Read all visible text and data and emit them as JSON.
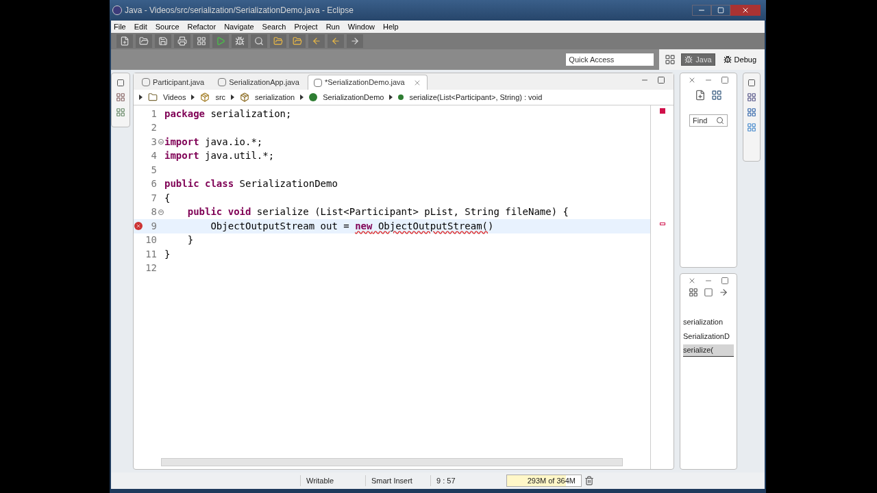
{
  "window": {
    "title": "Java - Videos/src/serialization/SerializationDemo.java - Eclipse"
  },
  "menu": [
    "File",
    "Edit",
    "Source",
    "Refactor",
    "Navigate",
    "Search",
    "Project",
    "Run",
    "Window",
    "Help"
  ],
  "quick_access": {
    "placeholder": "Quick Access"
  },
  "perspectives": [
    {
      "label": "Java",
      "selected": true
    },
    {
      "label": "Debug",
      "selected": false
    }
  ],
  "editor_tabs": [
    {
      "label": "Participant.java",
      "selected": false
    },
    {
      "label": "SerializationApp.java",
      "selected": false
    },
    {
      "label": "*SerializationDemo.java",
      "selected": true
    }
  ],
  "breadcrumb": [
    {
      "label": "Videos",
      "kind": "project"
    },
    {
      "label": "src",
      "kind": "folder"
    },
    {
      "label": "serialization",
      "kind": "package"
    },
    {
      "label": "SerializationDemo",
      "kind": "class"
    },
    {
      "label": "serialize(List<Participant>, String) : void",
      "kind": "method"
    }
  ],
  "code_lines": [
    {
      "number": "1",
      "current": false,
      "error": false,
      "fold": false,
      "tokens": [
        {
          "text": "package",
          "kind": "keyword"
        },
        {
          "text": " serialization;",
          "kind": "plain"
        }
      ]
    },
    {
      "number": "2",
      "current": false,
      "error": false,
      "fold": false
    },
    {
      "number": "3",
      "current": false,
      "error": false,
      "fold": true,
      "tokens": [
        {
          "text": "import",
          "kind": "keyword"
        },
        {
          "text": " java.io.*;",
          "kind": "plain"
        }
      ]
    },
    {
      "number": "4",
      "current": false,
      "error": false,
      "fold": false,
      "tokens": [
        {
          "text": "import",
          "kind": "keyword"
        },
        {
          "text": " java.util.*;",
          "kind": "plain"
        }
      ]
    },
    {
      "number": "5",
      "current": false,
      "error": false,
      "fold": false
    },
    {
      "number": "6",
      "current": false,
      "error": false,
      "fold": false,
      "tokens": [
        {
          "text": "public class",
          "kind": "keyword"
        },
        {
          "text": " SerializationDemo",
          "kind": "plain"
        }
      ]
    },
    {
      "number": "7",
      "current": false,
      "error": false,
      "fold": false,
      "tokens": [
        {
          "text": "{",
          "kind": "plain"
        }
      ]
    },
    {
      "number": "8",
      "current": false,
      "error": false,
      "fold": true,
      "tokens": [
        {
          "text": "    public void",
          "kind": "keyword"
        },
        {
          "text": " serialize (List<Participant> pList, String fileName) {",
          "kind": "plain"
        }
      ]
    },
    {
      "number": "9",
      "current": true,
      "error": true,
      "fold": false,
      "tokens": [
        {
          "text": "        ObjectOutputStream out = ",
          "kind": "plain"
        },
        {
          "text": "new",
          "kind": "keyword-error"
        },
        {
          "text": " ObjectOutputStream(",
          "kind": "error"
        },
        {
          "text": ")",
          "kind": "plain"
        }
      ]
    },
    {
      "number": "10",
      "current": false,
      "error": false,
      "fold": false,
      "tokens": [
        {
          "text": "    }",
          "kind": "plain"
        }
      ]
    },
    {
      "number": "11",
      "current": false,
      "error": false,
      "fold": false,
      "tokens": [
        {
          "text": "}",
          "kind": "plain"
        }
      ]
    },
    {
      "number": "12",
      "current": false,
      "error": false,
      "fold": false
    }
  ],
  "find": {
    "placeholder": "Find"
  },
  "outline": [
    {
      "label": "serialization",
      "selected": false
    },
    {
      "label": "SerializationD",
      "selected": false
    },
    {
      "label": "serialize(",
      "selected": true
    }
  ],
  "status_bar": [
    "Writable",
    "Smart Insert",
    "9 : 57"
  ],
  "memory": {
    "label": "293M of 364M",
    "level": 0.8
  }
}
